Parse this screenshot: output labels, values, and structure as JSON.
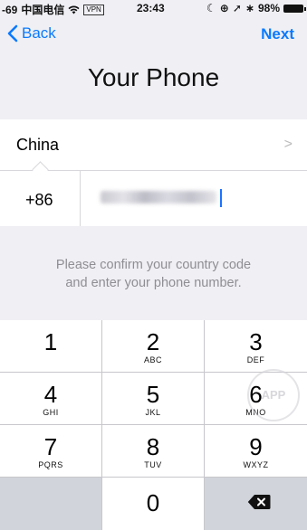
{
  "status_bar": {
    "signal": "-69",
    "carrier": "中国电信",
    "vpn": "VPN",
    "time": "23:43",
    "battery": "98%"
  },
  "nav": {
    "back_label": "Back",
    "next_label": "Next",
    "accent_color": "#0a7aff"
  },
  "title": "Your Phone",
  "country": {
    "name": "China",
    "chevron": ">"
  },
  "phone": {
    "country_code": "+86",
    "number_value": ""
  },
  "hint": {
    "line1": "Please confirm your country code",
    "line2": "and enter your phone number."
  },
  "keypad": {
    "keys": [
      {
        "digit": "1",
        "letters": ""
      },
      {
        "digit": "2",
        "letters": "ABC"
      },
      {
        "digit": "3",
        "letters": "DEF"
      },
      {
        "digit": "4",
        "letters": "GHI"
      },
      {
        "digit": "5",
        "letters": "JKL"
      },
      {
        "digit": "6",
        "letters": "MNO"
      },
      {
        "digit": "7",
        "letters": "PQRS"
      },
      {
        "digit": "8",
        "letters": "TUV"
      },
      {
        "digit": "9",
        "letters": "WXYZ"
      },
      {
        "digit": "0",
        "letters": ""
      }
    ],
    "delete_icon": "backspace-icon"
  },
  "watermark": "APP"
}
